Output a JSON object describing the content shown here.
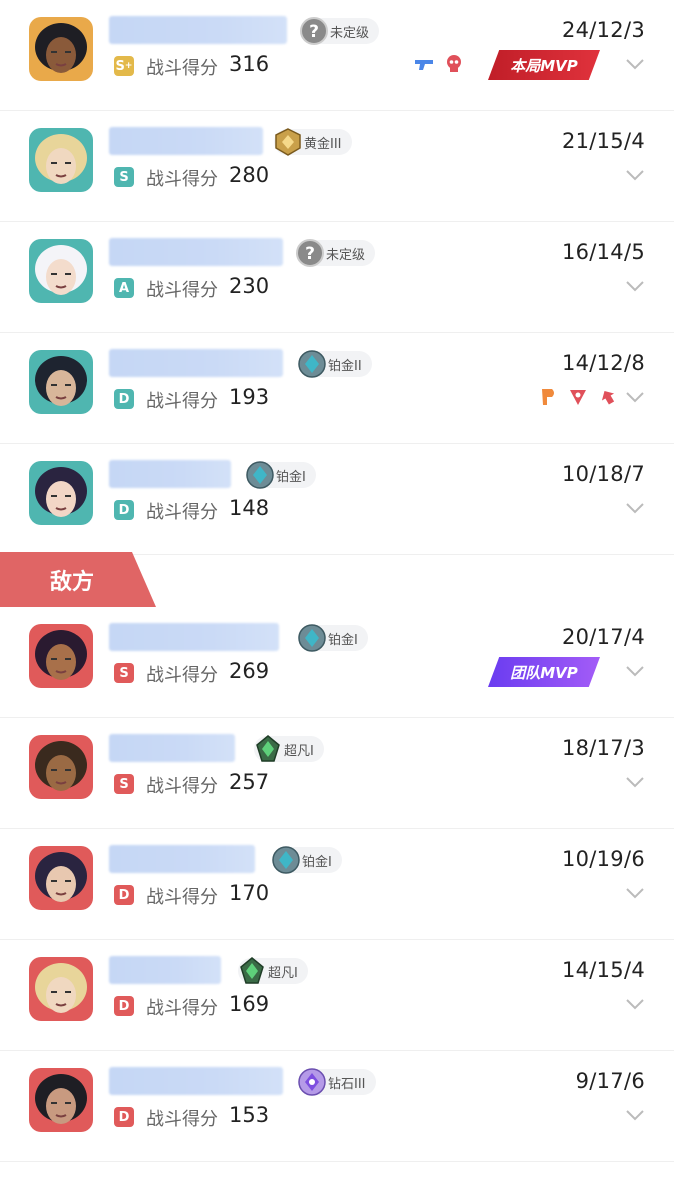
{
  "colors": {
    "grade_ally": "#e3b94a",
    "grade_ally_teal": "#4fb6b0",
    "grade_enemy": "#e05a5a",
    "banner": "#e06565"
  },
  "section_enemy": "敌方",
  "score_label": "战斗得分",
  "players": [
    {
      "grade": "S",
      "grade_plus": "+",
      "grade_color": "#e3b94a",
      "score": "316",
      "kda": "24/12/3",
      "rank": "未定级",
      "rank_icon": "question-icon",
      "mvp": "本局MVP",
      "mvp_type": "red",
      "extras": [
        "gun-icon",
        "skull-icon"
      ],
      "avatar_bg": "#e9a94a",
      "team": "ally"
    },
    {
      "grade": "S",
      "grade_color": "#4fb6b0",
      "score": "280",
      "kda": "21/15/4",
      "rank": "黄金III",
      "rank_icon": "gold-rank-icon",
      "avatar_bg": "#4fb6b0",
      "team": "ally"
    },
    {
      "grade": "A",
      "grade_color": "#4fb6b0",
      "score": "230",
      "kda": "16/14/5",
      "rank": "未定级",
      "rank_icon": "question-icon",
      "avatar_bg": "#4fb6b0",
      "team": "ally"
    },
    {
      "grade": "D",
      "grade_color": "#4fb6b0",
      "score": "193",
      "kda": "14/12/8",
      "rank": "铂金II",
      "rank_icon": "platinum-rank-icon",
      "extras": [
        "flag-icon",
        "triangle-icon",
        "arrow-icon"
      ],
      "avatar_bg": "#4fb6b0",
      "team": "ally"
    },
    {
      "grade": "D",
      "grade_color": "#4fb6b0",
      "score": "148",
      "kda": "10/18/7",
      "rank": "铂金I",
      "rank_icon": "platinum-rank-icon",
      "avatar_bg": "#4fb6b0",
      "team": "ally"
    },
    {
      "grade": "S",
      "grade_color": "#e05a5a",
      "score": "269",
      "kda": "20/17/4",
      "rank": "铂金I",
      "rank_icon": "platinum-rank-icon",
      "mvp": "团队MVP",
      "mvp_type": "purple",
      "avatar_bg": "#e05a5a",
      "team": "enemy"
    },
    {
      "grade": "S",
      "grade_color": "#e05a5a",
      "score": "257",
      "kda": "18/17/3",
      "rank": "超凡I",
      "rank_icon": "ascendant-rank-icon",
      "avatar_bg": "#e05a5a",
      "team": "enemy"
    },
    {
      "grade": "D",
      "grade_color": "#e05a5a",
      "score": "170",
      "kda": "10/19/6",
      "rank": "铂金I",
      "rank_icon": "platinum-rank-icon",
      "avatar_bg": "#e05a5a",
      "team": "enemy"
    },
    {
      "grade": "D",
      "grade_color": "#e05a5a",
      "score": "169",
      "kda": "14/15/4",
      "rank": "超凡I",
      "rank_icon": "ascendant-rank-icon",
      "avatar_bg": "#e05a5a",
      "team": "enemy"
    },
    {
      "grade": "D",
      "grade_color": "#e05a5a",
      "score": "153",
      "kda": "9/17/6",
      "rank": "钻石III",
      "rank_icon": "diamond-rank-icon",
      "avatar_bg": "#e05a5a",
      "team": "enemy"
    }
  ]
}
